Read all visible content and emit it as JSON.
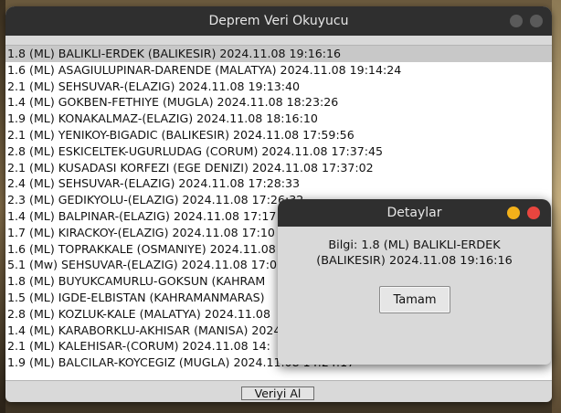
{
  "main_window": {
    "title": "Deprem Veri Okuyucu",
    "fetch_button_label": "Veriyi Al",
    "list": [
      "1.8 (ML) BALIKLI-ERDEK (BALIKESIR) 2024.11.08 19:16:16",
      "1.6 (ML) ASAGIULUPINAR-DARENDE (MALATYA) 2024.11.08 19:14:24",
      "2.1 (ML) SEHSUVAR-(ELAZIG) 2024.11.08 19:13:40",
      "1.4 (ML) GOKBEN-FETHIYE (MUGLA) 2024.11.08 18:23:26",
      "1.9 (ML) KONAKALMAZ-(ELAZIG) 2024.11.08 18:16:10",
      "2.1 (ML) YENIKOY-BIGADIC (BALIKESIR) 2024.11.08 17:59:56",
      "2.8 (ML) ESKICELTEK-UGURLUDAG (CORUM) 2024.11.08 17:37:45",
      "2.1 (ML) KUSADASI KORFEZI (EGE DENIZI) 2024.11.08 17:37:02",
      "2.4 (ML) SEHSUVAR-(ELAZIG) 2024.11.08 17:28:33",
      "2.3 (ML) GEDIKYOLU-(ELAZIG) 2024.11.08 17:26:32",
      "1.4 (ML) BALPINAR-(ELAZIG) 2024.11.08 17:17",
      "1.7 (ML) KIRACKOY-(ELAZIG) 2024.11.08 17:10",
      "1.6 (ML) TOPRAKKALE (OSMANIYE) 2024.11.08",
      "5.1 (Mw) SEHSUVAR-(ELAZIG) 2024.11.08 17:0",
      "1.8 (ML) BUYUKCAMURLU-GOKSUN (KAHRAM",
      "1.5 (ML) IGDE-ELBISTAN (KAHRAMANMARAS)",
      "2.8 (ML) KOZLUK-KALE (MALATYA) 2024.11.08",
      "1.4 (ML) KARABORKLU-AKHISAR (MANISA) 2024",
      "2.1 (ML) KALEHISAR-(CORUM) 2024.11.08 14:",
      "1.9 (ML) BALCILAR-KOYCEGIZ (MUGLA) 2024.11.08 14:24:17"
    ]
  },
  "dialog": {
    "title": "Detaylar",
    "message_line1": "Bilgi: 1.8 (ML) BALIKLI-ERDEK",
    "message_line2": "(BALIKESIR) 2024.11.08 19:16:16",
    "ok_label": "Tamam"
  }
}
